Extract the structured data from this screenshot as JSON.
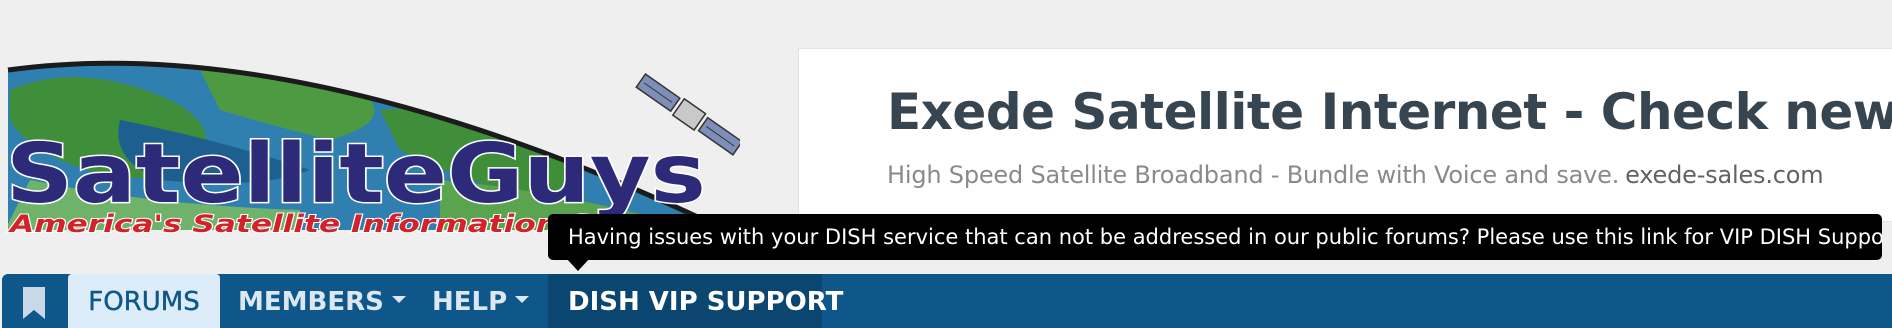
{
  "logo": {
    "wordmark": "SatelliteGuys",
    "wordmark_part1": "Satellite",
    "wordmark_part2": "uys",
    "tagline": "America's Satellite Information Source"
  },
  "ad": {
    "title": "Exede Satellite Internet - Check new offers in",
    "description": "High Speed Satellite Broadband - Bundle with Voice and save.",
    "url": "exede-sales.com"
  },
  "tooltip": {
    "text": "Having issues with your DISH service that can not be addressed in our public forums? Please use this link for VIP DISH Support!"
  },
  "nav": {
    "bookmark_icon": "bookmark-icon",
    "items": [
      {
        "label": "FORUMS",
        "active": true
      },
      {
        "label": "MEMBERS",
        "has_dropdown": true
      },
      {
        "label": "HELP",
        "has_dropdown": true
      },
      {
        "label": "DISH VIP SUPPORT",
        "hovered": true
      }
    ]
  },
  "colors": {
    "nav_bg": "#0f578a",
    "nav_active_bg": "#dcedf9",
    "nav_hover_bg": "#0b4670",
    "tooltip_bg": "#000000",
    "logo_text": "#2e2a7a",
    "logo_tagline": "#d2232a",
    "page_bg": "#efefef"
  }
}
